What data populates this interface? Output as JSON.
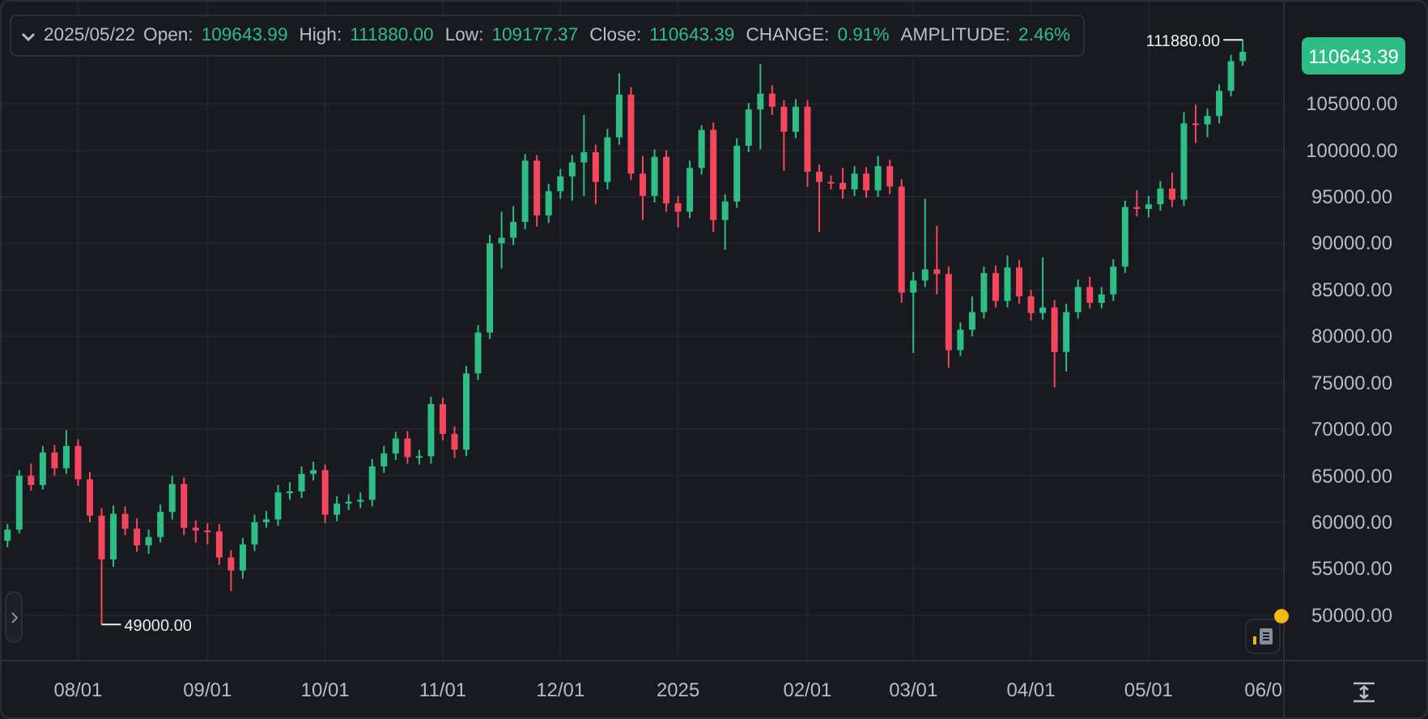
{
  "legend": {
    "expanded": true,
    "date": "2025/05/22",
    "fields": [
      {
        "label": "Open:",
        "value": "109643.99"
      },
      {
        "label": "High:",
        "value": "111880.00"
      },
      {
        "label": "Low:",
        "value": "109177.37"
      },
      {
        "label": "Close:",
        "value": "110643.39"
      },
      {
        "label": "CHANGE:",
        "value": "0.91%"
      },
      {
        "label": "AMPLITUDE:",
        "value": "2.46%"
      }
    ]
  },
  "last_price": "110643.39",
  "edge_time_label": "06/0",
  "chart_data": {
    "type": "candlestick",
    "grid": true,
    "categories": [
      null,
      null,
      null,
      null,
      null,
      null,
      "08/01",
      null,
      null,
      null,
      null,
      null,
      null,
      null,
      null,
      null,
      null,
      "09/01",
      null,
      null,
      null,
      null,
      null,
      null,
      null,
      null,
      null,
      "10/01",
      null,
      null,
      null,
      null,
      null,
      null,
      null,
      null,
      null,
      "11/01",
      null,
      null,
      null,
      null,
      null,
      null,
      null,
      null,
      null,
      "12/01",
      null,
      null,
      null,
      null,
      null,
      null,
      null,
      null,
      null,
      "2025",
      null,
      null,
      null,
      null,
      null,
      null,
      null,
      null,
      null,
      null,
      "02/01",
      null,
      null,
      null,
      null,
      null,
      null,
      null,
      null,
      "03/01",
      null,
      null,
      null,
      null,
      null,
      null,
      null,
      null,
      null,
      "04/01",
      null,
      null,
      null,
      null,
      null,
      null,
      null,
      null,
      null,
      "05/01",
      null,
      null,
      null,
      null,
      null,
      null,
      null,
      null,
      null,
      null,
      null
    ],
    "ohlc": [
      [
        58000,
        59800,
        57300,
        59200
      ],
      [
        59200,
        65600,
        58800,
        65000
      ],
      [
        65000,
        66300,
        63400,
        64000
      ],
      [
        64000,
        68200,
        63500,
        67500
      ],
      [
        67500,
        68300,
        65000,
        65800
      ],
      [
        65800,
        69900,
        65200,
        68200
      ],
      [
        68200,
        68900,
        63900,
        64600
      ],
      [
        64600,
        65400,
        60000,
        60700
      ],
      [
        60700,
        61500,
        49000,
        56000
      ],
      [
        56000,
        61800,
        55200,
        60900
      ],
      [
        60900,
        61700,
        58600,
        59300
      ],
      [
        59300,
        60400,
        56800,
        57500
      ],
      [
        57500,
        59200,
        56600,
        58400
      ],
      [
        58400,
        61900,
        57800,
        61100
      ],
      [
        61100,
        65000,
        60300,
        64100
      ],
      [
        64100,
        64800,
        58600,
        59400
      ],
      [
        59400,
        60200,
        57800,
        59100
      ],
      [
        59100,
        59900,
        57600,
        59000
      ],
      [
        59000,
        59800,
        55400,
        56200
      ],
      [
        56200,
        57000,
        52600,
        54800
      ],
      [
        54800,
        58300,
        53900,
        57600
      ],
      [
        57600,
        60800,
        56900,
        60000
      ],
      [
        60000,
        61200,
        59400,
        60300
      ],
      [
        60300,
        64000,
        59600,
        63200
      ],
      [
        63200,
        64300,
        62400,
        63300
      ],
      [
        63300,
        66000,
        62600,
        65200
      ],
      [
        65200,
        66500,
        64500,
        65600
      ],
      [
        65600,
        66200,
        59900,
        60800
      ],
      [
        60800,
        62800,
        60100,
        62000
      ],
      [
        62000,
        63000,
        61300,
        62200
      ],
      [
        62200,
        63200,
        61500,
        62400
      ],
      [
        62400,
        66800,
        61700,
        66000
      ],
      [
        66000,
        68200,
        65300,
        67400
      ],
      [
        67400,
        69700,
        66700,
        69000
      ],
      [
        69000,
        69800,
        66300,
        67000
      ],
      [
        67000,
        67800,
        66200,
        67100
      ],
      [
        67100,
        73500,
        66300,
        72700
      ],
      [
        72700,
        73400,
        68800,
        69500
      ],
      [
        69500,
        70300,
        66900,
        67800
      ],
      [
        67800,
        76800,
        67100,
        76000
      ],
      [
        76000,
        81200,
        75300,
        80400
      ],
      [
        80400,
        90900,
        79700,
        90000
      ],
      [
        90000,
        93400,
        87300,
        90600
      ],
      [
        90600,
        94000,
        89800,
        92300
      ],
      [
        92300,
        99600,
        91500,
        98900
      ],
      [
        98900,
        99500,
        91800,
        93000
      ],
      [
        93000,
        96400,
        92200,
        95600
      ],
      [
        95600,
        98000,
        94800,
        97200
      ],
      [
        97200,
        99500,
        94600,
        98700
      ],
      [
        98700,
        103800,
        95100,
        99800
      ],
      [
        99800,
        100600,
        94200,
        96600
      ],
      [
        96600,
        102300,
        95800,
        101400
      ],
      [
        101400,
        108300,
        100600,
        106000
      ],
      [
        106000,
        106800,
        96800,
        97500
      ],
      [
        97500,
        99400,
        92500,
        95100
      ],
      [
        95100,
        100100,
        94400,
        99300
      ],
      [
        99300,
        100000,
        93400,
        94300
      ],
      [
        94300,
        95100,
        91700,
        93400
      ],
      [
        93400,
        98900,
        92700,
        98100
      ],
      [
        98100,
        102700,
        97400,
        102200
      ],
      [
        102200,
        103000,
        91200,
        92500
      ],
      [
        92500,
        95300,
        89300,
        94500
      ],
      [
        94500,
        101300,
        93800,
        100500
      ],
      [
        100500,
        105100,
        99800,
        104400
      ],
      [
        104400,
        109300,
        100100,
        106100
      ],
      [
        106100,
        107000,
        103800,
        104700
      ],
      [
        104700,
        105400,
        97800,
        102000
      ],
      [
        102000,
        105500,
        101300,
        104700
      ],
      [
        104700,
        105400,
        96100,
        97700
      ],
      [
        97700,
        98500,
        91200,
        96600
      ],
      [
        96600,
        97300,
        95800,
        96500
      ],
      [
        96500,
        98100,
        94800,
        95800
      ],
      [
        95800,
        98300,
        95100,
        97500
      ],
      [
        97500,
        98200,
        94900,
        95700
      ],
      [
        95700,
        99400,
        95000,
        98300
      ],
      [
        98300,
        99000,
        95300,
        96100
      ],
      [
        96100,
        96900,
        83600,
        84700
      ],
      [
        84700,
        86900,
        78200,
        86000
      ],
      [
        86000,
        94800,
        85300,
        87200
      ],
      [
        87200,
        91900,
        84500,
        86700
      ],
      [
        86700,
        87500,
        76600,
        78500
      ],
      [
        78500,
        81500,
        77900,
        80700
      ],
      [
        80700,
        84300,
        80000,
        82600
      ],
      [
        82600,
        87500,
        81900,
        86800
      ],
      [
        86800,
        87600,
        83100,
        83800
      ],
      [
        83800,
        88700,
        83100,
        87400
      ],
      [
        87400,
        88200,
        83500,
        84300
      ],
      [
        84300,
        85000,
        81700,
        82500
      ],
      [
        82500,
        88500,
        81800,
        83100
      ],
      [
        83100,
        83900,
        74500,
        78300
      ],
      [
        78300,
        83500,
        76200,
        82600
      ],
      [
        82600,
        86100,
        81900,
        85300
      ],
      [
        85300,
        86400,
        83000,
        83600
      ],
      [
        83600,
        85300,
        83000,
        84500
      ],
      [
        84500,
        88300,
        83800,
        87500
      ],
      [
        87500,
        94600,
        86800,
        93900
      ],
      [
        93900,
        95700,
        92900,
        93700
      ],
      [
        93700,
        95100,
        92800,
        94200
      ],
      [
        94200,
        96700,
        93500,
        95900
      ],
      [
        95900,
        97600,
        93900,
        94700
      ],
      [
        94700,
        104100,
        94000,
        102900
      ],
      [
        102900,
        104900,
        100800,
        102800
      ],
      [
        102800,
        104500,
        101400,
        103700
      ],
      [
        103700,
        107100,
        102900,
        106400
      ],
      [
        106400,
        110300,
        105800,
        109600
      ],
      [
        109600,
        111880,
        109100,
        110600
      ],
      null,
      null,
      null
    ],
    "ylim": [
      39000,
      116000
    ],
    "yticks": [
      {
        "value": 50000,
        "label": "50000.00"
      },
      {
        "value": 55000,
        "label": "55000.00"
      },
      {
        "value": 60000,
        "label": "60000.00"
      },
      {
        "value": 65000,
        "label": "65000.00"
      },
      {
        "value": 70000,
        "label": "70000.00"
      },
      {
        "value": 75000,
        "label": "75000.00"
      },
      {
        "value": 80000,
        "label": "80000.00"
      },
      {
        "value": 85000,
        "label": "85000.00"
      },
      {
        "value": 90000,
        "label": "90000.00"
      },
      {
        "value": 95000,
        "label": "95000.00"
      },
      {
        "value": 100000,
        "label": "100000.00"
      },
      {
        "value": 105000,
        "label": "105000.00"
      }
    ],
    "annotations": [
      "49000.00",
      "111880.00"
    ]
  },
  "alert_badge": true
}
